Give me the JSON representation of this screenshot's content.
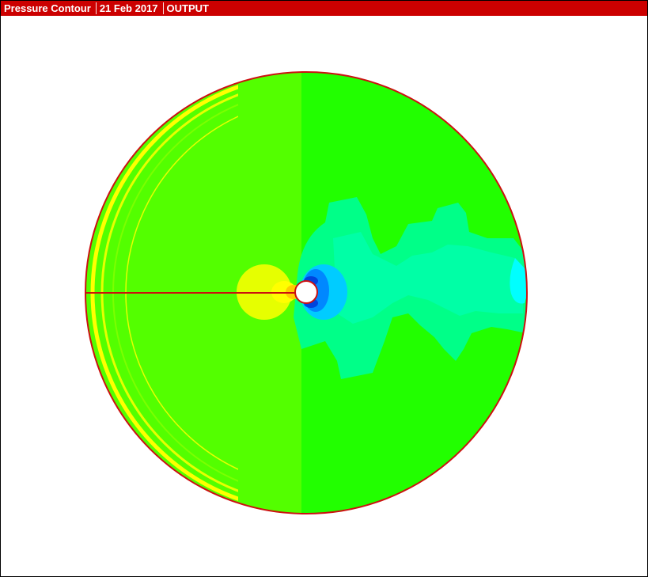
{
  "titlebar": {
    "segments": [
      "Pressure Contour",
      "21 Feb 2017",
      "OUTPUT"
    ]
  },
  "plot": {
    "field": "pressure",
    "domain_shape": "circle",
    "obstacle": "circular-cylinder",
    "cut_line": "horizontal-radius-left",
    "colors": {
      "boundary": "#cc1010",
      "cut_line": "#cc1010",
      "ambient": "#22ff00",
      "upstream_band": "#7cff00",
      "leading_ring": "#e6ff00",
      "yellow_band": "#ffff00",
      "stagnation_inner": "#ffcc00",
      "stagnation_core": "#ff9900",
      "wake_light": "#00ff88",
      "wake_mid": "#00ffbb",
      "wake_cyan": "#00ffff",
      "suction_light": "#00ccff",
      "suction_mid": "#0088ff",
      "suction_core": "#0044dd",
      "obstacle_fill": "#ffffff"
    }
  },
  "theme": {
    "titlebar_bg": "#cc0000",
    "titlebar_fg": "#ffffff"
  }
}
